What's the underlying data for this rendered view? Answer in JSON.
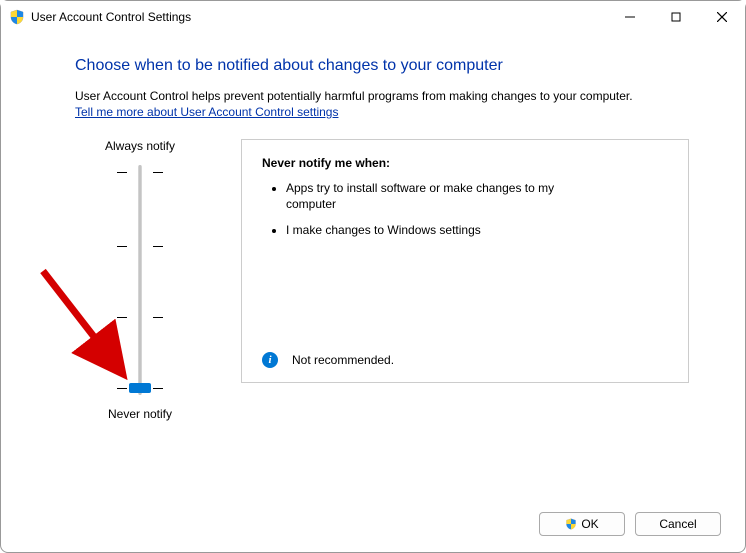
{
  "window": {
    "title": "User Account Control Settings"
  },
  "header": {
    "instruction": "Choose when to be notified about changes to your computer",
    "description": "User Account Control helps prevent potentially harmful programs from making changes to your computer.",
    "link_text": "Tell me more about User Account Control settings"
  },
  "slider": {
    "top_label": "Always notify",
    "bottom_label": "Never notify",
    "position_index": 3,
    "tick_count": 4
  },
  "panel": {
    "heading": "Never notify me when:",
    "bullets": [
      "Apps try to install software or make changes to my computer",
      "I make changes to Windows settings"
    ],
    "footer_text": "Not recommended."
  },
  "buttons": {
    "ok": "OK",
    "cancel": "Cancel"
  },
  "colors": {
    "accent": "#0078d4",
    "link": "#0033aa"
  },
  "annotation": {
    "type": "arrow",
    "color": "#d40000",
    "points_to": "slider-thumb"
  }
}
